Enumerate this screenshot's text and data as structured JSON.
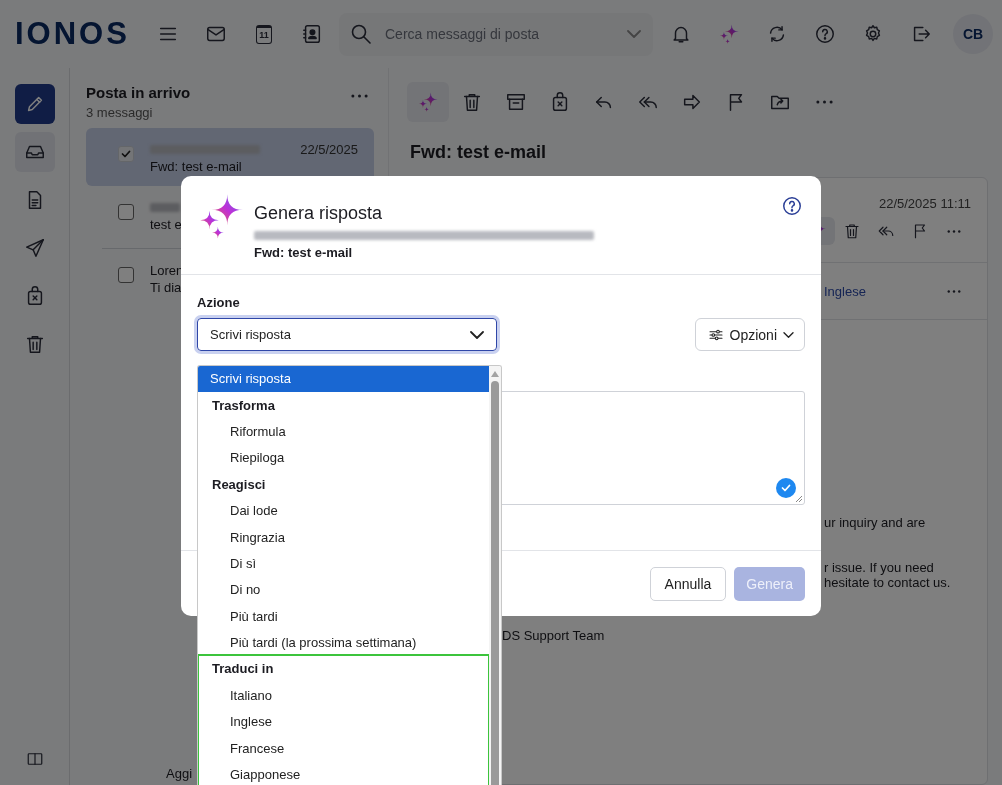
{
  "topbar": {
    "logo": "IONOS",
    "calendar_day": "11",
    "search": {
      "placeholder": "Cerca messaggi di posta"
    },
    "avatar": "CB"
  },
  "folder": {
    "title": "Posta in arrivo",
    "count": "3 messaggi",
    "footer": "Aggi"
  },
  "messages": [
    {
      "date": "22/5/2025",
      "subject": "Fwd: test e-mail",
      "checked": true,
      "selected": true
    },
    {
      "subject": "test e",
      "checked": false,
      "selected": false
    },
    {
      "subject": "Loren",
      "preview": "Ti dia",
      "checked": false,
      "selected": false
    }
  ],
  "reading": {
    "title": "Fwd: test e-mail",
    "date": "22/5/2025 11:11",
    "translate_link": "Inglese",
    "body": [
      "ur inquiry and are",
      "r issue. If you need",
      "hesitate to contact us.",
      "DS Support Team"
    ]
  },
  "dialog": {
    "title": "Genera risposta",
    "subject": "Fwd: test e-mail",
    "action_label": "Azione",
    "action_value": "Scrivi risposta",
    "options_button": "Opzioni",
    "cancel_button": "Annulla",
    "generate_button": {
      "label": "Genera",
      "disabled": true
    }
  },
  "dropdown": {
    "entries": [
      {
        "kind": "option",
        "label": "Scrivi risposta",
        "selected": true
      },
      {
        "kind": "group",
        "label": "Trasforma",
        "highlighted": false,
        "children": [
          {
            "kind": "option",
            "label": "Riformula",
            "selected": false
          },
          {
            "kind": "option",
            "label": "Riepiloga",
            "selected": false
          }
        ]
      },
      {
        "kind": "group",
        "label": "Reagisci",
        "highlighted": false,
        "children": [
          {
            "kind": "option",
            "label": "Dai lode",
            "selected": false
          },
          {
            "kind": "option",
            "label": "Ringrazia",
            "selected": false
          },
          {
            "kind": "option",
            "label": "Di sì",
            "selected": false
          },
          {
            "kind": "option",
            "label": "Di no",
            "selected": false
          },
          {
            "kind": "option",
            "label": "Più tardi",
            "selected": false
          },
          {
            "kind": "option",
            "label": "Più tardi (la prossima settimana)",
            "selected": false
          }
        ]
      },
      {
        "kind": "group",
        "label": "Traduci in",
        "highlighted": true,
        "children": [
          {
            "kind": "option",
            "label": "Italiano",
            "selected": false
          },
          {
            "kind": "option",
            "label": "Inglese",
            "selected": false
          },
          {
            "kind": "option",
            "label": "Francese",
            "selected": false
          },
          {
            "kind": "option",
            "label": "Giapponese",
            "selected": false
          }
        ]
      }
    ]
  }
}
